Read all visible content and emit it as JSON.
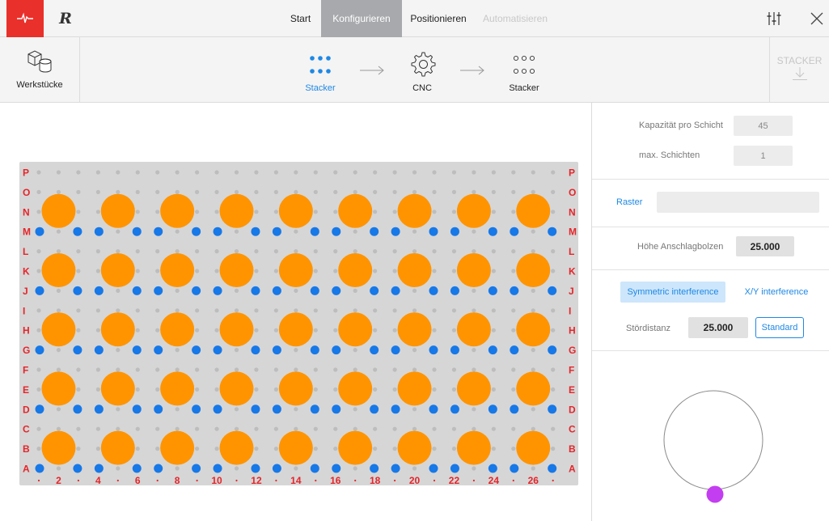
{
  "topbar": {
    "tabs": [
      "Start",
      "Konfigurieren",
      "Positionieren",
      "Automatisieren"
    ],
    "active_tab": "Konfigurieren",
    "logo_letter": "R",
    "icons": [
      "pulse-icon",
      "r-logo-icon",
      "sliders-icon",
      "close-icon"
    ]
  },
  "workflow": {
    "workpieces_label": "Werkstücke",
    "steps": [
      "Stacker",
      "CNC",
      "Stacker"
    ],
    "active_step": "Stacker",
    "stacker_button_label": "STACKER"
  },
  "grid": {
    "row_labels": [
      "P",
      "O",
      "N",
      "M",
      "L",
      "K",
      "J",
      "I",
      "H",
      "G",
      "F",
      "E",
      "D",
      "C",
      "B",
      "A"
    ],
    "column_labels": [
      "2",
      "4",
      "6",
      "8",
      "10",
      "12",
      "14",
      "16",
      "18",
      "20",
      "22",
      "24",
      "26"
    ],
    "parts_per_row": 9,
    "part_rows": 5,
    "colors": {
      "part": "#ff9400",
      "pin": "#1778e8",
      "hole": "#bdbdbd",
      "label": "#e5252a",
      "board": "#d6d6d6"
    }
  },
  "settings": {
    "capacity_label": "Kapazität pro Schicht",
    "capacity_value": "45",
    "layers_label": "max. Schichten",
    "layers_value": "1",
    "raster_label": "Raster",
    "raster_value": "",
    "stop_pin_label": "Höhe Anschlagbolzen",
    "stop_pin_value": "25.000",
    "symmetric_label": "Symmetric interference",
    "xy_label": "X/Y interference",
    "interference_label": "Stördistanz",
    "interference_value": "25.000",
    "standard_label": "Standard"
  },
  "rotation": {
    "handle_color": "#c33ef0",
    "circle_color": "#8a8a8a"
  }
}
